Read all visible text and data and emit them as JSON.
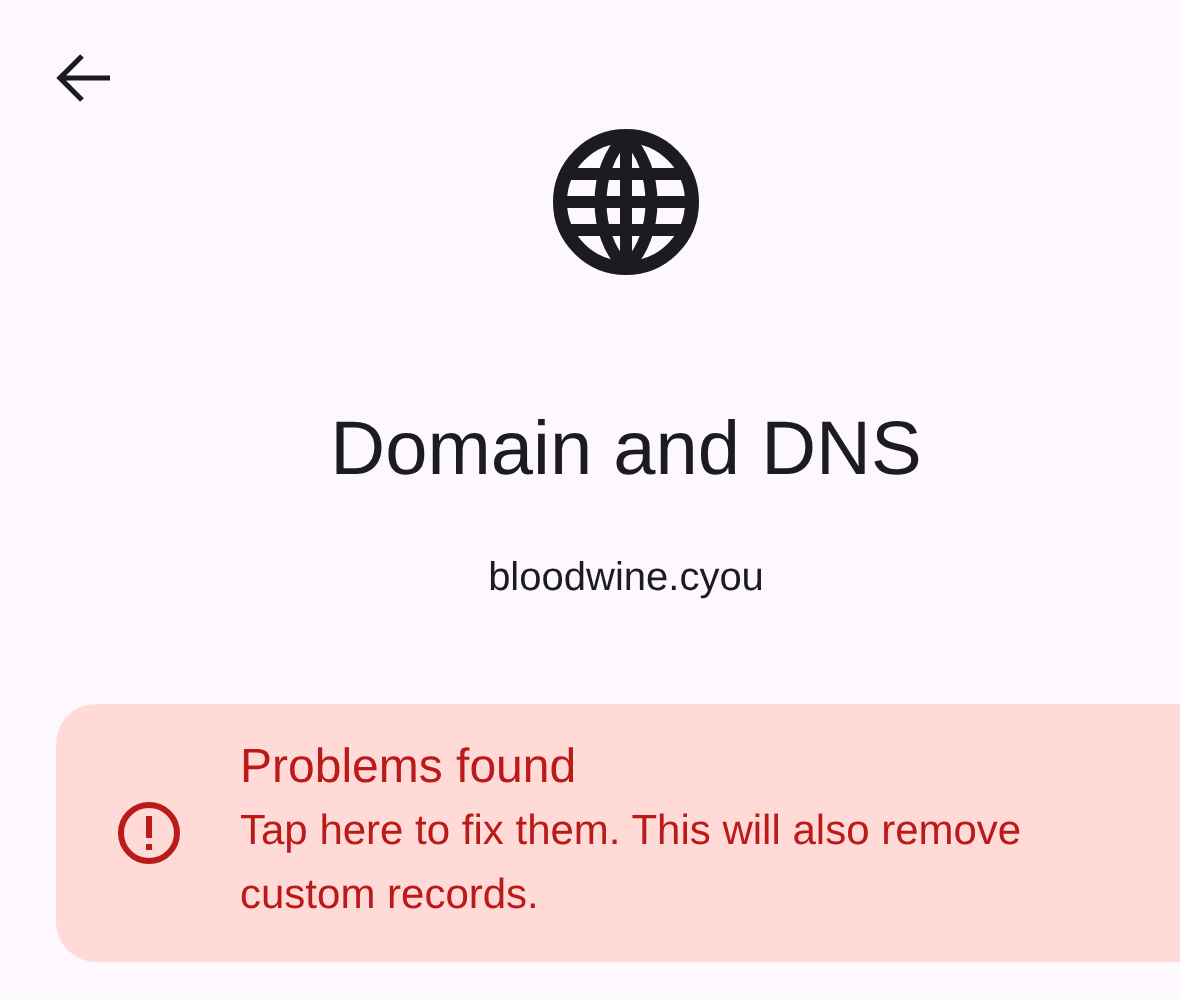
{
  "header": {
    "title": "Domain and DNS",
    "subtitle": "bloodwine.cyou"
  },
  "alert": {
    "kind": "error",
    "title": "Problems found",
    "message": "Tap here to fix them. This will also remove custom records."
  }
}
